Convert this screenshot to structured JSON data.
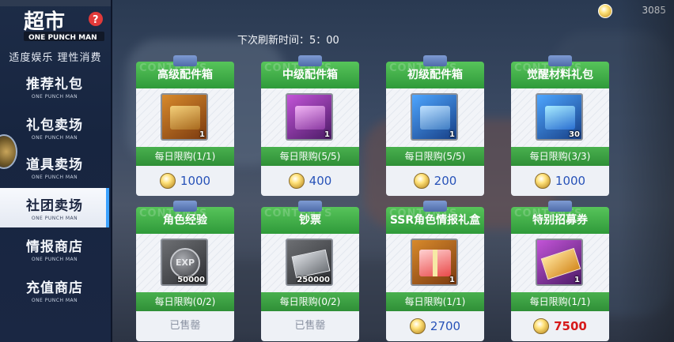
{
  "app": {
    "logo_text": "超市",
    "logo_sub": "ONE PUNCH MAN",
    "tagline": "适度娱乐 理性消费"
  },
  "currency": {
    "icon": "coin-icon",
    "value": "3085"
  },
  "refresh_text": "下次刷新时间：5：00",
  "sidebar": {
    "items": [
      {
        "label": "推荐礼包",
        "sub": "ONE PUNCH MAN",
        "active": false
      },
      {
        "label": "礼包卖场",
        "sub": "ONE PUNCH MAN",
        "active": false
      },
      {
        "label": "道具卖场",
        "sub": "ONE PUNCH MAN",
        "active": false
      },
      {
        "label": "社团卖场",
        "sub": "ONE PUNCH MAN",
        "active": true
      },
      {
        "label": "情报商店",
        "sub": "ONE PUNCH MAN",
        "active": false
      },
      {
        "label": "充值商店",
        "sub": "ONE PUNCH MAN",
        "active": false
      }
    ]
  },
  "cards": [
    {
      "ghost": "CONTENTS",
      "title": "高级配件箱",
      "qty": "1",
      "limit": "每日限购(1/1)",
      "price": "1000",
      "price_style": "normal",
      "icon": "orange-crate-icon"
    },
    {
      "ghost": "CONTENTS",
      "title": "中级配件箱",
      "qty": "1",
      "limit": "每日限购(5/5)",
      "price": "400",
      "price_style": "normal",
      "icon": "purple-crate-icon"
    },
    {
      "ghost": "CONTENTS",
      "title": "初级配件箱",
      "qty": "1",
      "limit": "每日限购(5/5)",
      "price": "200",
      "price_style": "normal",
      "icon": "blue-crate-icon"
    },
    {
      "ghost": "CONTENTS",
      "title": "觉醒材料礼包",
      "qty": "30",
      "limit": "每日限购(3/3)",
      "price": "1000",
      "price_style": "normal",
      "icon": "blue-box-icon"
    },
    {
      "ghost": "CONTENTS",
      "title": "角色经验",
      "qty": "50000",
      "limit": "每日限购(0/2)",
      "price": "已售罄",
      "price_style": "sold",
      "icon": "exp-coin-icon"
    },
    {
      "ghost": "CONTENTS",
      "title": "钞票",
      "qty": "250000",
      "limit": "每日限购(0/2)",
      "price": "已售罄",
      "price_style": "sold",
      "icon": "cash-stack-icon"
    },
    {
      "ghost": "CONTENTS",
      "title": "SSR角色情报礼盒",
      "qty": "1",
      "limit": "每日限购(1/1)",
      "price": "2700",
      "price_style": "normal",
      "icon": "gift-box-icon"
    },
    {
      "ghost": "CONTENTS",
      "title": "特别招募券",
      "qty": "1",
      "limit": "每日限购(1/1)",
      "price": "7500",
      "price_style": "red",
      "icon": "ticket-icon"
    }
  ]
}
